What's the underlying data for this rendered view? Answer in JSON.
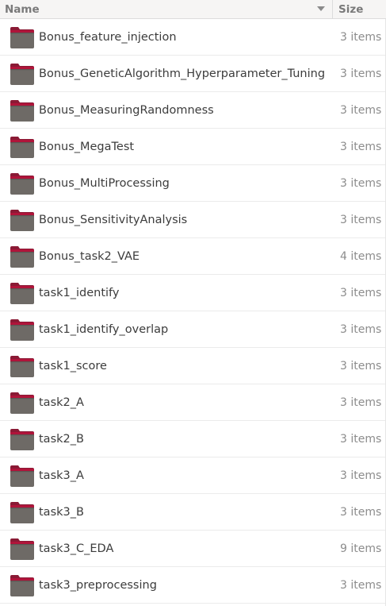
{
  "columns": {
    "name": "Name",
    "size": "Size"
  },
  "sort": {
    "icon": "sort-descending-icon"
  },
  "rows": [
    {
      "name": "Bonus_feature_injection",
      "size": "3 items"
    },
    {
      "name": "Bonus_GeneticAlgorithm_Hyperparameter_Tuning",
      "size": "3 items"
    },
    {
      "name": "Bonus_MeasuringRandomness",
      "size": "3 items"
    },
    {
      "name": "Bonus_MegaTest",
      "size": "3 items"
    },
    {
      "name": "Bonus_MultiProcessing",
      "size": "3 items"
    },
    {
      "name": "Bonus_SensitivityAnalysis",
      "size": "3 items"
    },
    {
      "name": "Bonus_task2_VAE",
      "size": "4 items"
    },
    {
      "name": "task1_identify",
      "size": "3 items"
    },
    {
      "name": "task1_identify_overlap",
      "size": "3 items"
    },
    {
      "name": "task1_score",
      "size": "3 items"
    },
    {
      "name": "task2_A",
      "size": "3 items"
    },
    {
      "name": "task2_B",
      "size": "3 items"
    },
    {
      "name": "task3_A",
      "size": "3 items"
    },
    {
      "name": "task3_B",
      "size": "3 items"
    },
    {
      "name": "task3_C_EDA",
      "size": "9 items"
    },
    {
      "name": "task3_preprocessing",
      "size": "3 items"
    }
  ],
  "colors": {
    "folder_body": "#6e6a66",
    "folder_tab": "#b0143a",
    "folder_back": "#8a1a35"
  }
}
